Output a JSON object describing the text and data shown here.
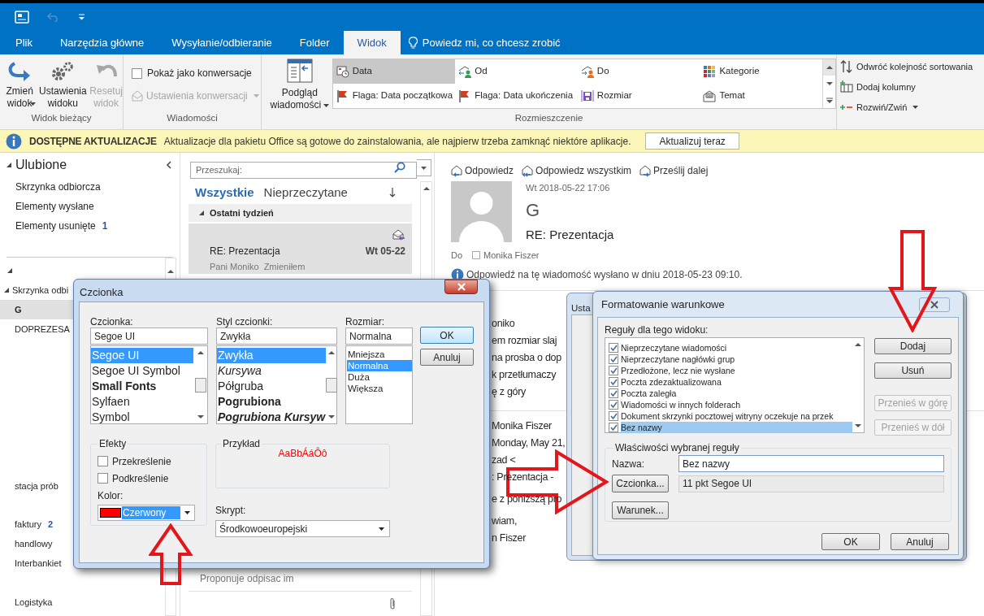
{
  "quick_access": {
    "undo_enabled": false
  },
  "ribbon_tabs": [
    {
      "label": "Plik",
      "selected": false
    },
    {
      "label": "Narzędzia główne",
      "selected": false
    },
    {
      "label": "Wysyłanie/odbieranie",
      "selected": false
    },
    {
      "label": "Folder",
      "selected": false
    },
    {
      "label": "Widok",
      "selected": true
    }
  ],
  "tell_me": "Powiedz mi, co chcesz zrobić",
  "view_group": {
    "label": "Widok bieżący",
    "buttons": [
      {
        "label": "Zmień widok",
        "kind": "change",
        "disabled": false,
        "dropdown": true
      },
      {
        "label": "Ustawienia widoku",
        "kind": "settings",
        "disabled": false,
        "dropdown": false
      },
      {
        "label": "Resetuj widok",
        "kind": "reset",
        "disabled": true,
        "dropdown": false
      }
    ]
  },
  "messages_group": {
    "label": "Wiadomości",
    "show_conversations": {
      "label": "Pokaż jako konwersacje",
      "checked": false
    },
    "conversation_settings": {
      "label": "Ustawienia konwersacji",
      "disabled": true
    }
  },
  "arrangement_group": {
    "label": "Rozmieszczenie",
    "reading_pane": "Podgląd wiadomości",
    "options": [
      {
        "label": "Data",
        "kind": "date",
        "selected": true
      },
      {
        "label": "Od",
        "kind": "from",
        "selected": false
      },
      {
        "label": "Do",
        "kind": "to",
        "selected": false
      },
      {
        "label": "Kategorie",
        "kind": "categories",
        "selected": false
      },
      {
        "label": "Flaga: Data początkowa",
        "kind": "flag",
        "selected": false
      },
      {
        "label": "Flaga: Data ukończenia",
        "kind": "flag",
        "selected": false
      },
      {
        "label": "Rozmiar",
        "kind": "size",
        "selected": false
      },
      {
        "label": "Temat",
        "kind": "subject",
        "selected": false
      }
    ]
  },
  "sort_commands": [
    {
      "label": "Odwróć kolejność sortowania",
      "kind": "reverse"
    },
    {
      "label": "Dodaj kolumny",
      "kind": "columns"
    },
    {
      "label": "Rozwiń/Zwiń",
      "kind": "expand"
    }
  ],
  "update_bar": {
    "title": "DOSTĘPNE AKTUALIZACJE",
    "message": "Aktualizacje dla pakietu Office są gotowe do zainstalowania, ale najpierw trzeba zamknąć niektóre aplikacje.",
    "button": "Aktualizuj teraz"
  },
  "favorites": {
    "title": "Ulubione",
    "items": [
      {
        "label": "Skrzynka odbiorcza"
      },
      {
        "label": "Elementy wysłane"
      },
      {
        "label": "Elementy usunięte",
        "count": "1"
      }
    ]
  },
  "folders": [
    {
      "label": "Skrzynka odbi",
      "kind": "mailbox",
      "selected": false
    },
    {
      "label": "G",
      "kind": "folder",
      "selected": true
    },
    {
      "label": "DOPREZESA",
      "kind": "folder",
      "selected": false
    },
    {
      "label": "stacja prób",
      "kind": "folder",
      "selected": false
    },
    {
      "label": "faktury",
      "count": "2",
      "kind": "folder",
      "selected": false
    },
    {
      "label": "handlowy",
      "kind": "folder",
      "selected": false
    },
    {
      "label": "Interbankiet",
      "kind": "folder",
      "selected": false
    },
    {
      "label": "Logistyka",
      "kind": "folder",
      "selected": false
    }
  ],
  "message_list": {
    "search_placeholder": "Przeszukaj:",
    "filters": [
      {
        "label": "Wszystkie",
        "selected": true
      },
      {
        "label": "Nieprzeczytane",
        "selected": false
      }
    ],
    "group": "Ostatni tydzień",
    "messages": [
      {
        "subject": "RE: Prezentacja",
        "date": "Wt 05-22",
        "preview": "Pani Moniko  Zmieniłem",
        "selected": true
      }
    ],
    "bottom_preview": "Proponuje odpisac im"
  },
  "reading_pane": {
    "actions": [
      {
        "label": "Odpowiedz",
        "kind": "reply"
      },
      {
        "label": "Odpowiedz wszystkim",
        "kind": "reply_all"
      },
      {
        "label": "Prześlij dalej",
        "kind": "forward"
      }
    ],
    "date": "Wt 2018-05-22 17:06",
    "sender": "G",
    "subject": "RE: Prezentacja",
    "to_label": "Do",
    "to": "Monika Fiszer",
    "info": "Odpowiedź na tę wiadomość wysłano w dniu 2018-05-23 09:10.",
    "body": [
      {
        "kind": "paragraph",
        "lines": [
          "oniko",
          "em rozmiar slaj",
          "na prosba o dop",
          "k przetłumaczy",
          "ę z góry"
        ]
      },
      {
        "kind": "quote_header",
        "lines": [
          "Monika Fiszer",
          "Monday, May 21,",
          "zad <",
          ": Prezentacja -"
        ]
      },
      {
        "kind": "paragraph",
        "lines": [
          "e z poniższą pro"
        ]
      },
      {
        "kind": "paragraph",
        "lines": [
          "wiam,",
          "n Fiszer"
        ]
      }
    ]
  },
  "font_dialog": {
    "title": "Czcionka",
    "font": {
      "label": "Czcionka:",
      "value": "Segoe UI",
      "items": [
        {
          "label": "Segoe UI",
          "kind": "regular",
          "selected": true
        },
        {
          "label": "Segoe UI Symbol",
          "kind": "regular",
          "selected": false
        },
        {
          "label": "Small Fonts",
          "kind": "bold",
          "selected": false
        },
        {
          "label": "Sylfaen",
          "kind": "regular",
          "selected": false
        },
        {
          "label": "Symbol",
          "kind": "regular",
          "selected": false
        }
      ]
    },
    "style": {
      "label": "Styl czcionki:",
      "value": "Zwykła",
      "items": [
        {
          "label": "Zwykła",
          "kind": "regular",
          "selected": true
        },
        {
          "label": "Kursywa",
          "kind": "italic",
          "selected": false
        },
        {
          "label": "Półgruba",
          "kind": "regular",
          "selected": false
        },
        {
          "label": "Pogrubiona",
          "kind": "bold",
          "selected": false
        },
        {
          "label": "Pogrubiona Kursyw",
          "kind": "bold_italic",
          "selected": false
        }
      ]
    },
    "size": {
      "label": "Rozmiar:",
      "value": "Normalna",
      "items": [
        {
          "label": "Mniejsza",
          "selected": false
        },
        {
          "label": "Normalna",
          "selected": true
        },
        {
          "label": "Duża",
          "selected": false
        },
        {
          "label": "Większa",
          "selected": false
        }
      ]
    },
    "buttons": [
      "OK",
      "Anuluj"
    ],
    "effects": {
      "title": "Efekty",
      "options": [
        {
          "label": "Przekreślenie",
          "checked": false
        },
        {
          "label": "Podkreślenie",
          "checked": false
        }
      ],
      "color_label": "Kolor:",
      "color_name": "Czerwony",
      "color": "#ff0000"
    },
    "preview": {
      "title": "Przykład",
      "sample": "AaBbÁáÔô"
    },
    "script": {
      "label": "Skrypt:",
      "value": "Środkowoeuropejski"
    }
  },
  "back_dialog": {
    "title": "Usta"
  },
  "format_dialog": {
    "title": "Formatowanie warunkowe",
    "rules_label": "Reguły dla tego widoku:",
    "rules": [
      {
        "label": "Nieprzeczytane wiadomości",
        "checked": true,
        "selected": false
      },
      {
        "label": "Nieprzeczytane nagłówki grup",
        "checked": true,
        "selected": false
      },
      {
        "label": "Przedłożone, lecz nie wysłane",
        "checked": true,
        "selected": false
      },
      {
        "label": "Poczta zdezaktualizowana",
        "checked": true,
        "selected": false
      },
      {
        "label": "Poczta zaległa",
        "checked": true,
        "selected": false
      },
      {
        "label": "Wiadomości w innych folderach",
        "checked": true,
        "selected": false
      },
      {
        "label": "Dokument skrzynki pocztowej witryny oczekuje na przek",
        "checked": true,
        "selected": false
      },
      {
        "label": "Bez nazwy",
        "checked": true,
        "selected": true
      }
    ],
    "buttons": [
      {
        "label": "Dodaj",
        "disabled": false
      },
      {
        "label": "Usuń",
        "disabled": false
      },
      {
        "label": "Przenieś w górę",
        "disabled": true
      },
      {
        "label": "Przenieś w dół",
        "disabled": true
      }
    ],
    "properties": {
      "title": "Właściwości wybranej reguły",
      "name_label": "Nazwa:",
      "name": "Bez nazwy",
      "font_button": "Czcionka...",
      "font": "11 pkt Segoe UI",
      "condition_button": "Warunek..."
    },
    "footer": [
      "OK",
      "Anuluj"
    ]
  }
}
